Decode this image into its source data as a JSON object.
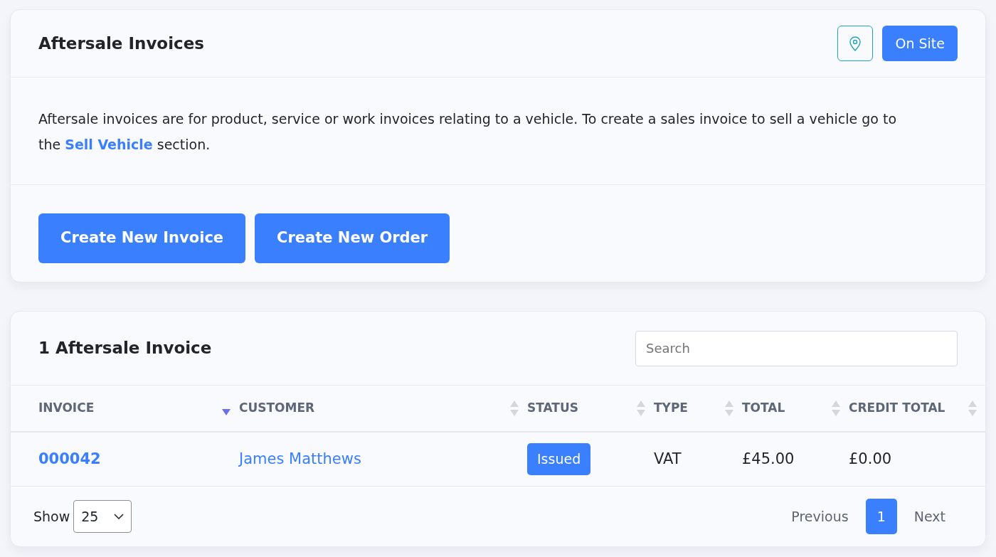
{
  "invoices_card": {
    "title": "Aftersale Invoices",
    "on_site_button": "On Site",
    "description": "Aftersale invoices are for product, service or work invoices relating to a vehicle. To create a sales invoice to sell a vehicle go to the",
    "description_link": "Sell Vehicle",
    "description_end": "section.",
    "buttons": [
      "Create New Invoice",
      "Create New Order"
    ]
  },
  "list_card": {
    "title": "1 Aftersale Invoice",
    "search": {
      "placeholder": "Search"
    },
    "columns": [
      {
        "label": "INVOICE",
        "sorted": true
      },
      {
        "label": "CUSTOMER",
        "sorted": false
      },
      {
        "label": "STATUS",
        "sorted": false
      },
      {
        "label": "TYPE",
        "sorted": false
      },
      {
        "label": "TOTAL",
        "sorted": false
      },
      {
        "label": "CREDIT TOTAL",
        "sorted": false
      }
    ],
    "rows": [
      {
        "invoice": "000042",
        "customer": "James Matthews",
        "status": "Issued",
        "type": "VAT",
        "total": "£45.00",
        "credit_total": "£0.00"
      }
    ],
    "show_label": "Show",
    "page_size": "25",
    "pagination": [
      {
        "label": "Previous",
        "selected": false
      },
      {
        "label": "1",
        "selected": true
      },
      {
        "label": "Next",
        "selected": false
      }
    ]
  }
}
